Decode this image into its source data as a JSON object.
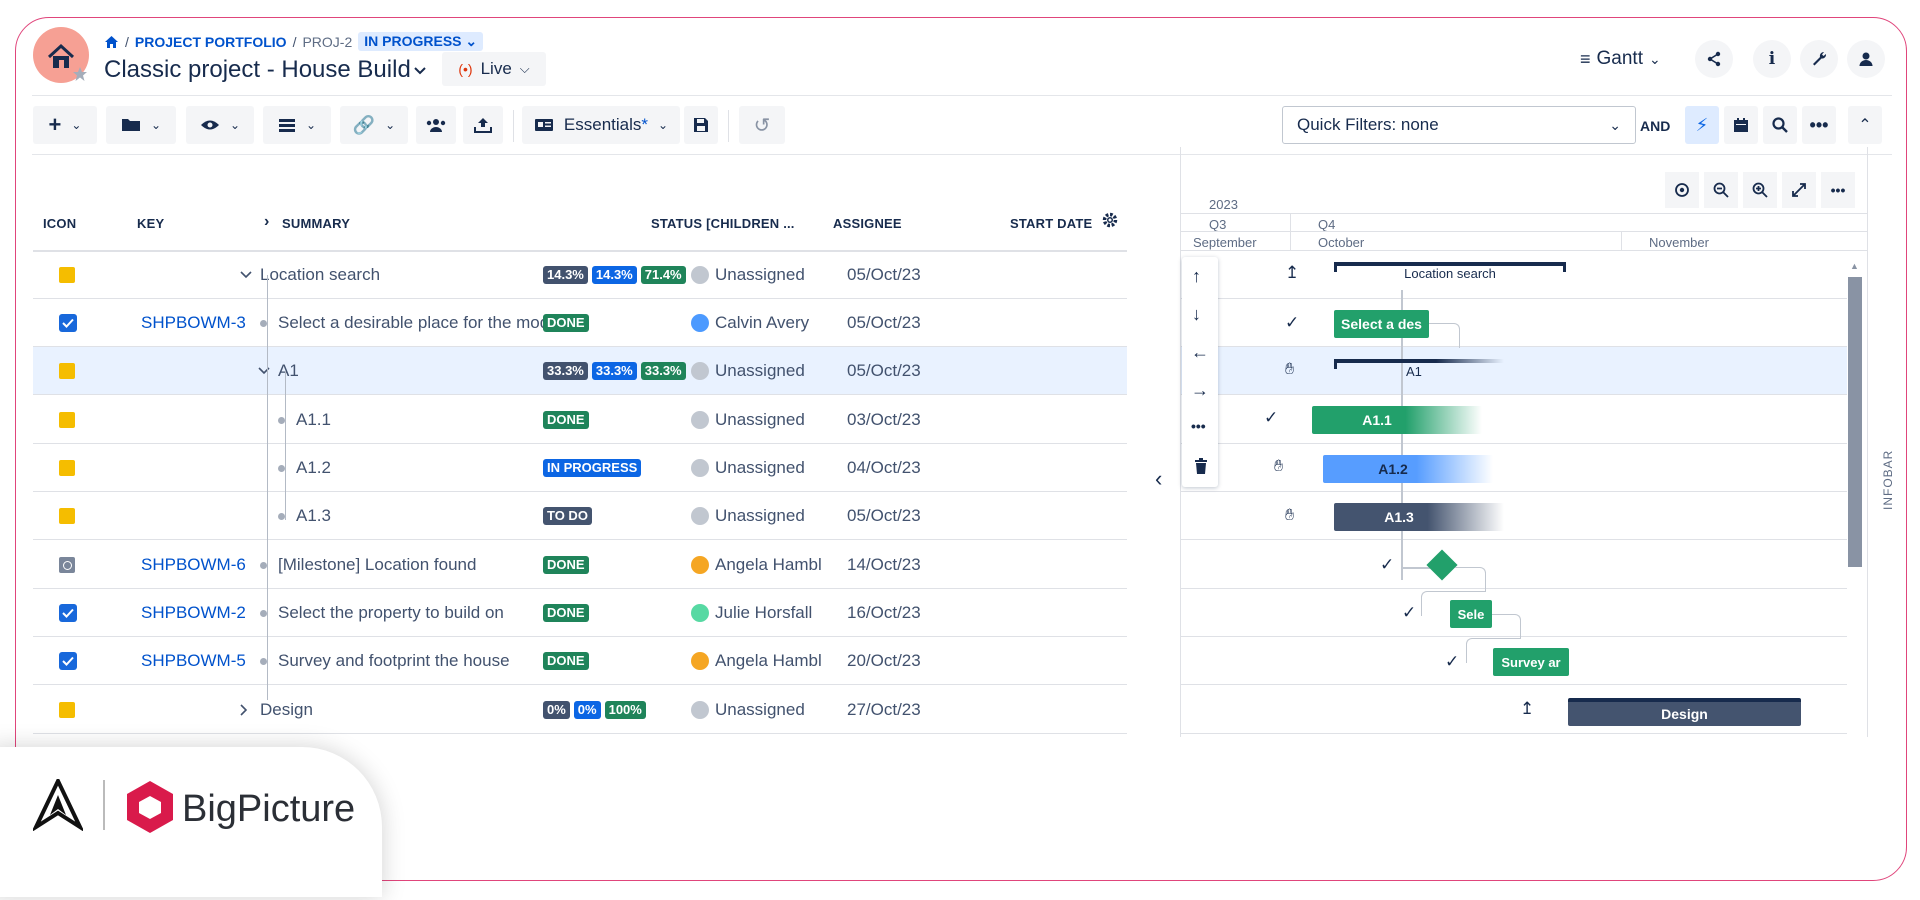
{
  "breadcrumb": {
    "portfolio": "PROJECT PORTFOLIO",
    "key": "PROJ-2",
    "status": "IN PROGRESS"
  },
  "project_title": "Classic project - House Build",
  "mode_label": "Live",
  "view_label": "Gantt",
  "toolbar": {
    "essentials_label": "Essentials",
    "essentials_mark": "*",
    "quick_filters": "Quick Filters: none",
    "and_label": "AND"
  },
  "columns": {
    "icon": "ICON",
    "key": "KEY",
    "summary": "SUMMARY",
    "status": "STATUS [CHILDREN ...",
    "assignee": "ASSIGNEE",
    "start": "START DATE"
  },
  "rows": [
    {
      "key": "",
      "summary": "Location search",
      "badges": [
        "14.3%",
        "14.3%",
        "71.4%"
      ],
      "assignee": "Unassigned",
      "start": "05/Oct/23"
    },
    {
      "key": "SHPBOWM-3",
      "summary": "Select a desirable place for the model hou...",
      "status": "DONE",
      "assignee": "Calvin Avery",
      "start": "05/Oct/23"
    },
    {
      "key": "",
      "summary": "A1",
      "badges": [
        "33.3%",
        "33.3%",
        "33.3%"
      ],
      "assignee": "Unassigned",
      "start": "05/Oct/23"
    },
    {
      "key": "",
      "summary": "A1.1",
      "status": "DONE",
      "assignee": "Unassigned",
      "start": "03/Oct/23"
    },
    {
      "key": "",
      "summary": "A1.2",
      "status": "IN PROGRESS",
      "assignee": "Unassigned",
      "start": "04/Oct/23"
    },
    {
      "key": "",
      "summary": "A1.3",
      "status": "TO DO",
      "assignee": "Unassigned",
      "start": "05/Oct/23"
    },
    {
      "key": "SHPBOWM-6",
      "summary": "[Milestone] Location found",
      "status": "DONE",
      "assignee": "Angela Hambleto",
      "start": "14/Oct/23"
    },
    {
      "key": "SHPBOWM-2",
      "summary": "Select the property to build on",
      "status": "DONE",
      "assignee": "Julie Horsfall",
      "start": "16/Oct/23"
    },
    {
      "key": "SHPBOWM-5",
      "summary": "Survey and footprint the house",
      "status": "DONE",
      "assignee": "Angela Hambleto",
      "start": "20/Oct/23"
    },
    {
      "key": "",
      "summary": "Design",
      "badges": [
        "0%",
        "0%",
        "100%"
      ],
      "assignee": "Unassigned",
      "start": "27/Oct/23"
    }
  ],
  "timeline": {
    "year": "2023",
    "q3": "Q3",
    "q4": "Q4",
    "sep": "September",
    "oct": "October",
    "nov": "November"
  },
  "gantt_bars": {
    "location_search": "Location search",
    "select_place": "Select a des",
    "a1": "A1",
    "a11": "A1.1",
    "a12": "A1.2",
    "a13": "A1.3",
    "select_property": "Sele",
    "survey": "Survey ar",
    "design": "Design"
  },
  "infobar_label": "INFOBAR",
  "brand_name": "BigPicture",
  "colors": {
    "done": "#1f845a",
    "progress": "#0c66e4",
    "todo": "#44546f",
    "accent": "#e0457b"
  }
}
